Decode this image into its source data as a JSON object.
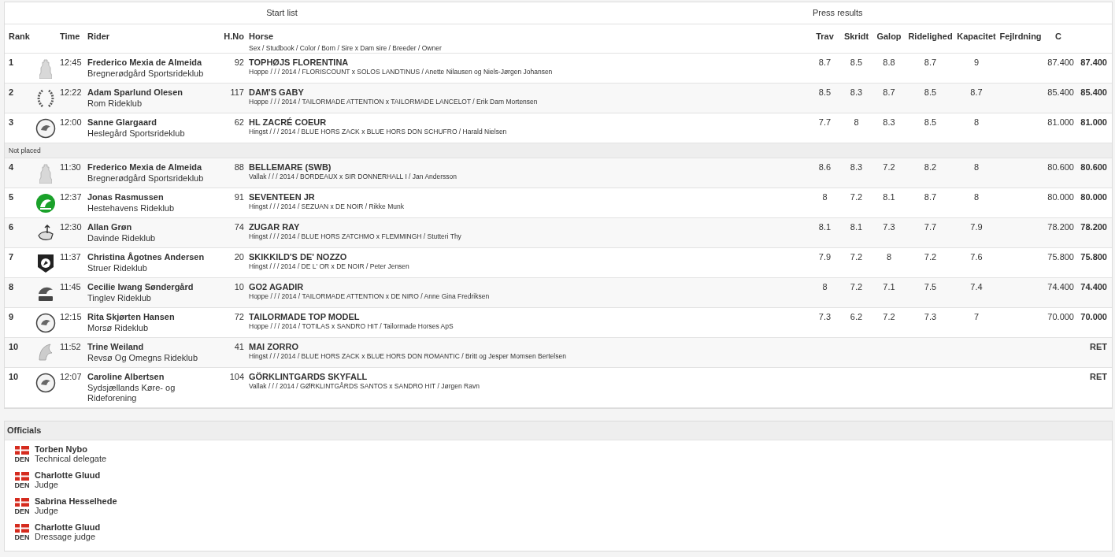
{
  "start_list": {
    "title": "Start list",
    "press_title": "Press results",
    "columns": {
      "rank": "Rank",
      "time": "Time",
      "rider": "Rider",
      "hno": "H.No",
      "horse": "Horse",
      "horse_sub": "Sex / Studbook / Color / Born / Sire x Dam sire / Breeder / Owner",
      "scores": {
        "trav": "Trav",
        "skridt": "Skridt",
        "galop": "Galop",
        "ridelighed": "Ridelighed",
        "kapacitet": "Kapacitet",
        "fejlrdning": "Fejlrdning",
        "c": "C"
      }
    },
    "rows": [
      {
        "kind": "entry",
        "rank": "1",
        "time": "12:45",
        "rider": "Frederico Mexia de Almeida",
        "club": "Bregnerødgård Sportsrideklub",
        "hno": "92",
        "horse": "TOPHØJS FLORENTINA",
        "horse_info": "Hoppe / / / 2014 / FLORISCOUNT x SOLOS LANDTINUS / Anette Nilausen og Niels-Jørgen Johansen",
        "scores": {
          "trav": "8.7",
          "skridt": "8.5",
          "galop": "8.8",
          "ridelighed": "8.7",
          "kapacitet": "9",
          "c": "87.400"
        },
        "total": "87.400"
      },
      {
        "kind": "entry",
        "rank": "2",
        "time": "12:22",
        "rider": "Adam Sparlund Olesen",
        "club": "Rom Rideklub",
        "hno": "117",
        "horse": "DAM'S GABY",
        "horse_info": "Hoppe / / / 2014 / TAILORMADE ATTENTION x TAILORMADE LANCELOT / Erik Dam Mortensen",
        "scores": {
          "trav": "8.5",
          "skridt": "8.3",
          "galop": "8.7",
          "ridelighed": "8.5",
          "kapacitet": "8.7",
          "c": "85.400"
        },
        "total": "85.400"
      },
      {
        "kind": "entry",
        "rank": "3",
        "time": "12:00",
        "rider": "Sanne Glargaard",
        "club": "Heslegård Sportsrideklub",
        "hno": "62",
        "horse": "HL ZACRÉ COEUR",
        "horse_info": "Hingst / / / 2014 / BLUE HORS ZACK x BLUE HORS DON SCHUFRO / Harald Nielsen",
        "scores": {
          "trav": "7.7",
          "skridt": "8",
          "galop": "8.3",
          "ridelighed": "8.5",
          "kapacitet": "8",
          "c": "81.000"
        },
        "total": "81.000"
      },
      {
        "kind": "group",
        "label": "Not placed"
      },
      {
        "kind": "entry",
        "rank": "4",
        "time": "11:30",
        "rider": "Frederico Mexia de Almeida",
        "club": "Bregnerødgård Sportsrideklub",
        "hno": "88",
        "horse": "BELLEMARE (SWB)",
        "horse_info": "Vallak / / / 2014 / BORDEAUX x SIR DONNERHALL I / Jan Andersson",
        "scores": {
          "trav": "8.6",
          "skridt": "8.3",
          "galop": "7.2",
          "ridelighed": "8.2",
          "kapacitet": "8",
          "c": "80.600"
        },
        "total": "80.600"
      },
      {
        "kind": "entry",
        "rank": "5",
        "time": "12:37",
        "rider": "Jonas Rasmussen",
        "club": "Hestehavens Rideklub",
        "hno": "91",
        "horse": "SEVENTEEN JR",
        "horse_info": "Hingst / / / 2014 / SEZUAN x DE NOIR / Rikke Munk",
        "scores": {
          "trav": "8",
          "skridt": "7.2",
          "galop": "8.1",
          "ridelighed": "8.7",
          "kapacitet": "8",
          "c": "80.000"
        },
        "total": "80.000"
      },
      {
        "kind": "entry",
        "rank": "6",
        "time": "12:30",
        "rider": "Allan Grøn",
        "club": "Davinde Rideklub",
        "hno": "74",
        "horse": "ZUGAR RAY",
        "horse_info": "Hingst / / / 2014 / BLUE HORS ZATCHMO x FLEMMINGH / Stutteri Thy",
        "scores": {
          "trav": "8.1",
          "skridt": "8.1",
          "galop": "7.3",
          "ridelighed": "7.7",
          "kapacitet": "7.9",
          "c": "78.200"
        },
        "total": "78.200"
      },
      {
        "kind": "entry",
        "rank": "7",
        "time": "11:37",
        "rider": "Christina Ågotnes Andersen",
        "club": "Struer Rideklub",
        "hno": "20",
        "horse": "SKIKKILD'S DE' NOZZO",
        "horse_info": "Hingst / / / 2014 / DE L' OR x DE NOIR / Peter Jensen",
        "scores": {
          "trav": "7.9",
          "skridt": "7.2",
          "galop": "8",
          "ridelighed": "7.2",
          "kapacitet": "7.6",
          "c": "75.800"
        },
        "total": "75.800"
      },
      {
        "kind": "entry",
        "rank": "8",
        "time": "11:45",
        "rider": "Cecilie Iwang Søndergård",
        "club": "Tinglev Rideklub",
        "hno": "10",
        "horse": "GO2 AGADIR",
        "horse_info": "Hoppe / / / 2014 / TAILORMADE ATTENTION x DE NIRO / Anne Gina Fredriksen",
        "scores": {
          "trav": "8",
          "skridt": "7.2",
          "galop": "7.1",
          "ridelighed": "7.5",
          "kapacitet": "7.4",
          "c": "74.400"
        },
        "total": "74.400"
      },
      {
        "kind": "entry",
        "rank": "9",
        "time": "12:15",
        "rider": "Rita Skjørten Hansen",
        "club": "Morsø Rideklub",
        "hno": "72",
        "horse": "TAILORMADE TOP MODEL",
        "horse_info": "Hoppe / / / 2014 / TOTILAS x SANDRO HIT / Tailormade Horses ApS",
        "scores": {
          "trav": "7.3",
          "skridt": "6.2",
          "galop": "7.2",
          "ridelighed": "7.3",
          "kapacitet": "7",
          "c": "70.000"
        },
        "total": "70.000"
      },
      {
        "kind": "entry",
        "rank": "10",
        "time": "11:52",
        "rider": "Trine Weiland",
        "club": "Revsø Og Omegns Rideklub",
        "hno": "41",
        "horse": "MAI ZORRO",
        "horse_info": "Hingst / / / 2014 / BLUE HORS ZACK x BLUE HORS DON ROMANTIC / Britt og Jesper Momsen Bertelsen",
        "total": "RET"
      },
      {
        "kind": "entry",
        "rank": "10",
        "time": "12:07",
        "rider": "Caroline Albertsen",
        "club": "Sydsjællands Køre- og Rideforening",
        "hno": "104",
        "horse": "GÖRKLINTGARDS SKYFALL",
        "horse_info": "Vallak / / / 2014 / GØRKLINTGÅRDS SANTOS x SANDRO HIT / Jørgen Ravn",
        "total": "RET"
      }
    ]
  },
  "officials": {
    "title": "Officials",
    "items": [
      {
        "nation": "DEN",
        "name": "Torben Nybo",
        "role": "Technical delegate"
      },
      {
        "nation": "DEN",
        "name": "Charlotte Gluud",
        "role": "Judge"
      },
      {
        "nation": "DEN",
        "name": "Sabrina Hesselhede",
        "role": "Judge"
      },
      {
        "nation": "DEN",
        "name": "Charlotte Gluud",
        "role": "Dressage judge"
      }
    ]
  }
}
